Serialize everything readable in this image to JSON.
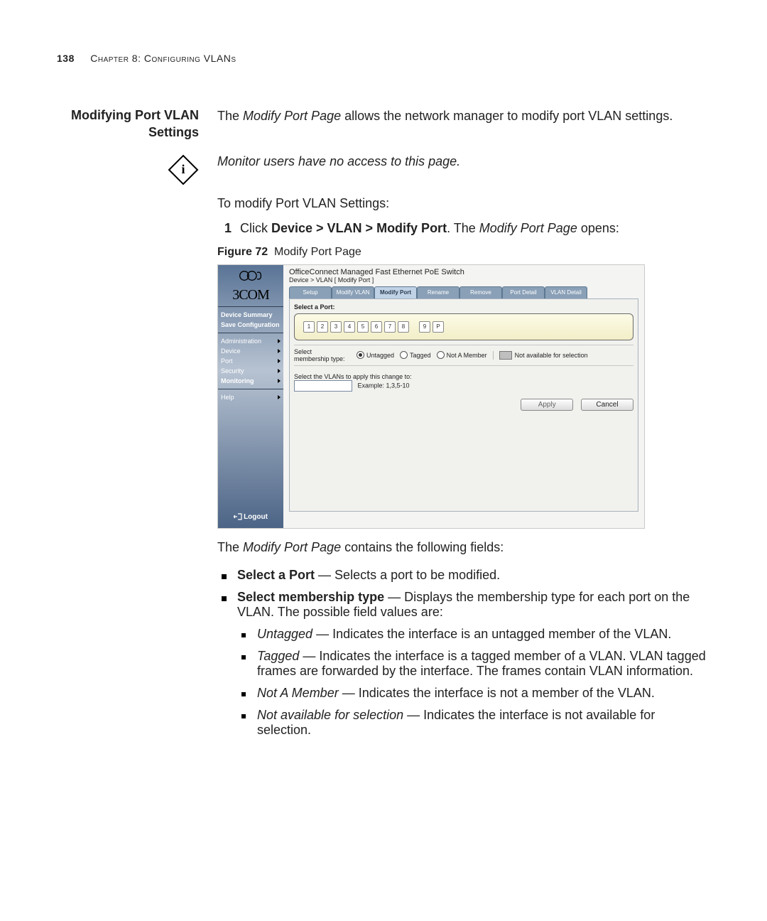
{
  "page": {
    "number": "138",
    "chapter_line": "Chapter 8: Configuring VLANs"
  },
  "heading": {
    "line1": "Modifying Port VLAN",
    "line2": "Settings"
  },
  "intro": {
    "pre": "The ",
    "em1": "Modify Port Page",
    "post": " allows the network manager to modify port VLAN settings."
  },
  "note": "Monitor users have no access to this page.",
  "lead": "To modify Port VLAN Settings:",
  "step1": {
    "num": "1",
    "pre": "Click ",
    "bold": "Device > VLAN > Modify Port",
    "mid": ". The ",
    "em": "Modify Port Page",
    "post": " opens:"
  },
  "figure": {
    "label": "Figure 72",
    "caption": "Modify Port Page",
    "brand": "3COM",
    "product_title": "OfficeConnect Managed Fast Ethernet PoE Switch",
    "breadcrumb": "Device > VLAN [ Modify Port ]",
    "side_links": {
      "summary": "Device Summary",
      "save": "Save Configuration"
    },
    "side_menu": [
      "Administration",
      "Device",
      "Port",
      "Security",
      "Monitoring"
    ],
    "side_help": "Help",
    "logout": "Logout",
    "tabs": [
      "Setup",
      "Modify VLAN",
      "Modify Port",
      "Rename",
      "Remove",
      "Port Detail",
      "VLAN Detail"
    ],
    "active_tab_index": 2,
    "panel": {
      "select_port": "Select a Port:",
      "ports": [
        "1",
        "2",
        "3",
        "4",
        "5",
        "6",
        "7",
        "8",
        "9",
        "P"
      ],
      "mem_label_1": "Select",
      "mem_label_2": "membership type:",
      "radios": [
        "Untagged",
        "Tagged",
        "Not A Member"
      ],
      "selected_radio_index": 0,
      "legend": "Not available for selection",
      "vlans_label": "Select the VLANs to apply this change to:",
      "example": "Example: 1,3,5-10",
      "apply": "Apply",
      "cancel": "Cancel"
    }
  },
  "after_fig": {
    "pre": "The ",
    "em": "Modify Port Page",
    "post": " contains the following fields:"
  },
  "fields": {
    "f1_b": "Select a Port",
    "f1_t": " — Selects a port to be modified.",
    "f2_b": "Select membership type",
    "f2_t": " — Displays the membership type for each port on the VLAN. The possible field values are:",
    "s1_i": "Untagged",
    "s1_t": " — Indicates the interface is an untagged member of the VLAN.",
    "s2_i": "Tagged",
    "s2_t": " — Indicates the interface is a tagged member of a VLAN. VLAN tagged frames are forwarded by the interface. The frames contain VLAN information.",
    "s3_i": "Not A Member",
    "s3_t": " — Indicates the interface is not a member of the VLAN.",
    "s4_i": "Not available for selection",
    "s4_t": " — Indicates the interface is not available for selection."
  }
}
